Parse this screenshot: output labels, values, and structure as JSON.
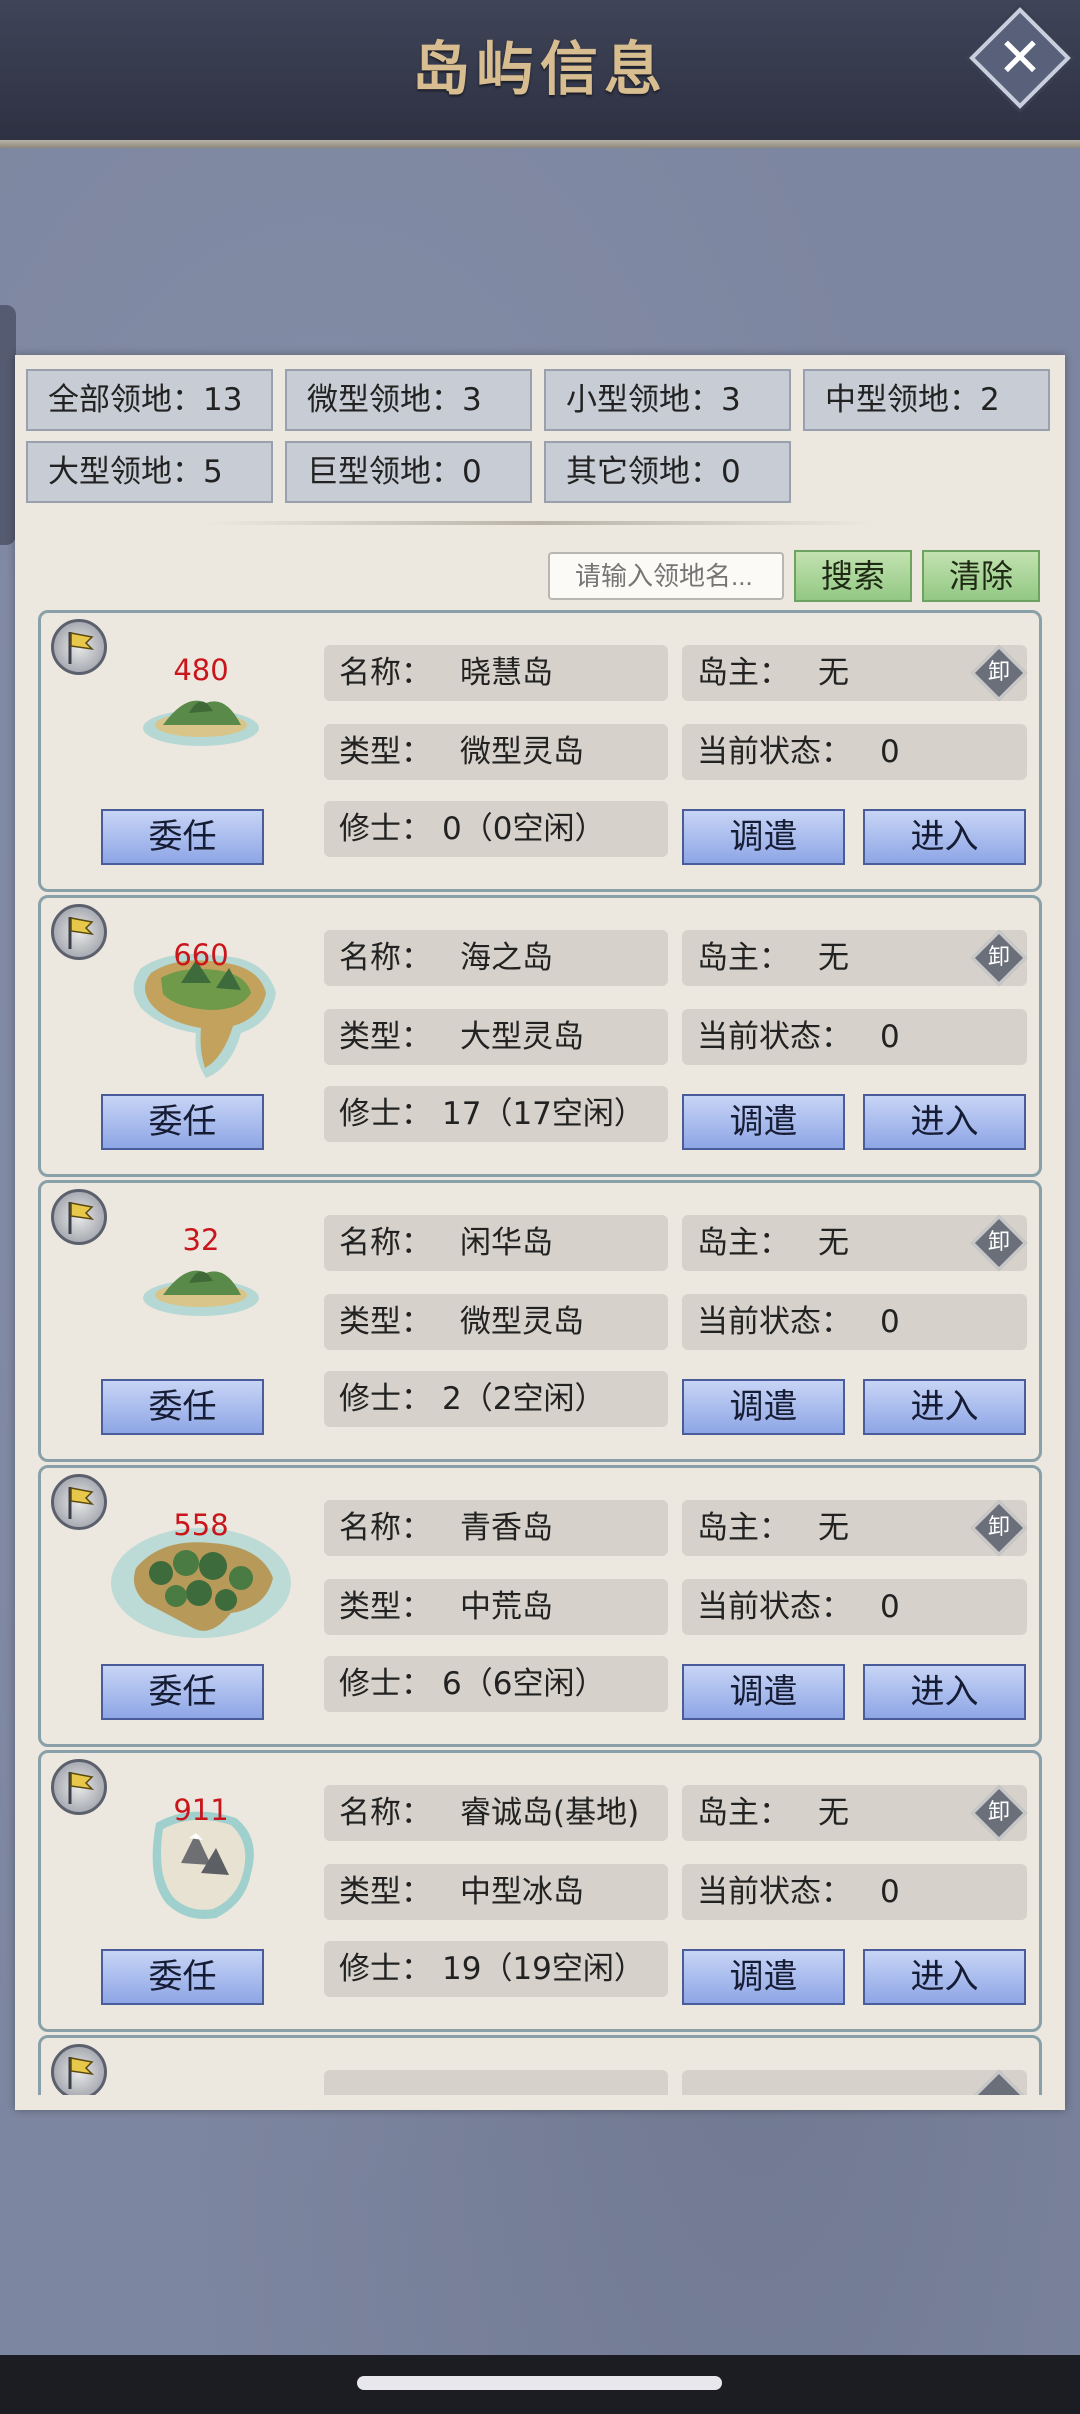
{
  "header": {
    "title": "岛屿信息",
    "close_icon": "close-icon"
  },
  "filters": [
    {
      "label": "全部领地：13"
    },
    {
      "label": "微型领地：3"
    },
    {
      "label": "小型领地：3"
    },
    {
      "label": "中型领地：2"
    },
    {
      "label": "大型领地：5"
    },
    {
      "label": "巨型领地：0"
    },
    {
      "label": "其它领地：0"
    }
  ],
  "search": {
    "placeholder": "请输入领地名...",
    "search_label": "搜索",
    "clear_label": "清除"
  },
  "labels": {
    "name": "名称：",
    "type": "类型：",
    "monks": "修士：",
    "owner": "岛主：",
    "state": "当前状态：",
    "appoint": "委任",
    "dispatch": "调遣",
    "enter": "进入",
    "unload": "卸"
  },
  "islands": [
    {
      "power": "480",
      "name": "晓慧岛",
      "type": "微型灵岛",
      "monks": "0（0空闲）",
      "owner": "无",
      "state": "0",
      "island_image": "small-green-island"
    },
    {
      "power": "660",
      "name": "海之岛",
      "type": "大型灵岛",
      "monks": "17（17空闲）",
      "owner": "无",
      "state": "0",
      "island_image": "large-green-island"
    },
    {
      "power": "32",
      "name": "闲华岛",
      "type": "微型灵岛",
      "monks": "2（2空闲）",
      "owner": "无",
      "state": "0",
      "island_image": "small-green-island"
    },
    {
      "power": "558",
      "name": "青香岛",
      "type": "中荒岛",
      "monks": "6（6空闲）",
      "owner": "无",
      "state": "0",
      "island_image": "forest-island"
    },
    {
      "power": "911",
      "name": "睿诚岛(基地)",
      "type": "中型冰岛",
      "monks": "19（19空闲）",
      "owner": "无",
      "state": "0",
      "island_image": "snow-island"
    }
  ],
  "colors": {
    "accent_red": "#c8161b",
    "button_blue": "#8ea6e6",
    "button_green": "#93c884",
    "title_gold": "#d7bd8f"
  }
}
